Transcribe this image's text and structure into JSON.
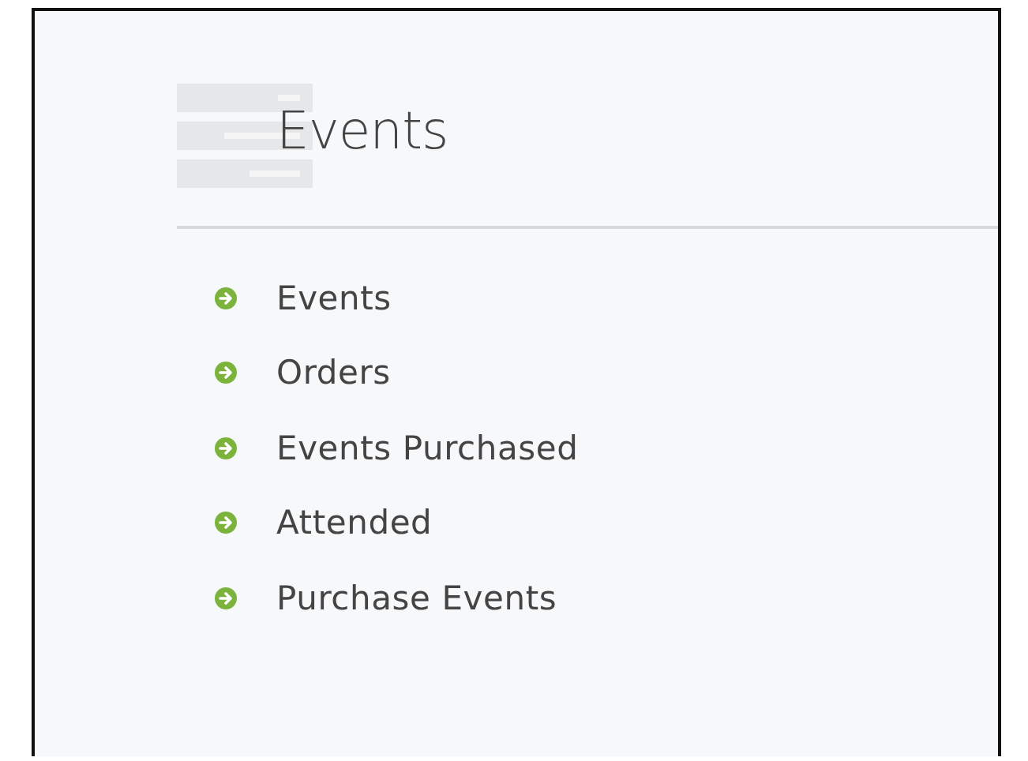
{
  "title": "Events",
  "menu": [
    {
      "label": "Events"
    },
    {
      "label": "Orders"
    },
    {
      "label": "Events Purchased"
    },
    {
      "label": "Attended"
    },
    {
      "label": "Purchase Events"
    }
  ]
}
